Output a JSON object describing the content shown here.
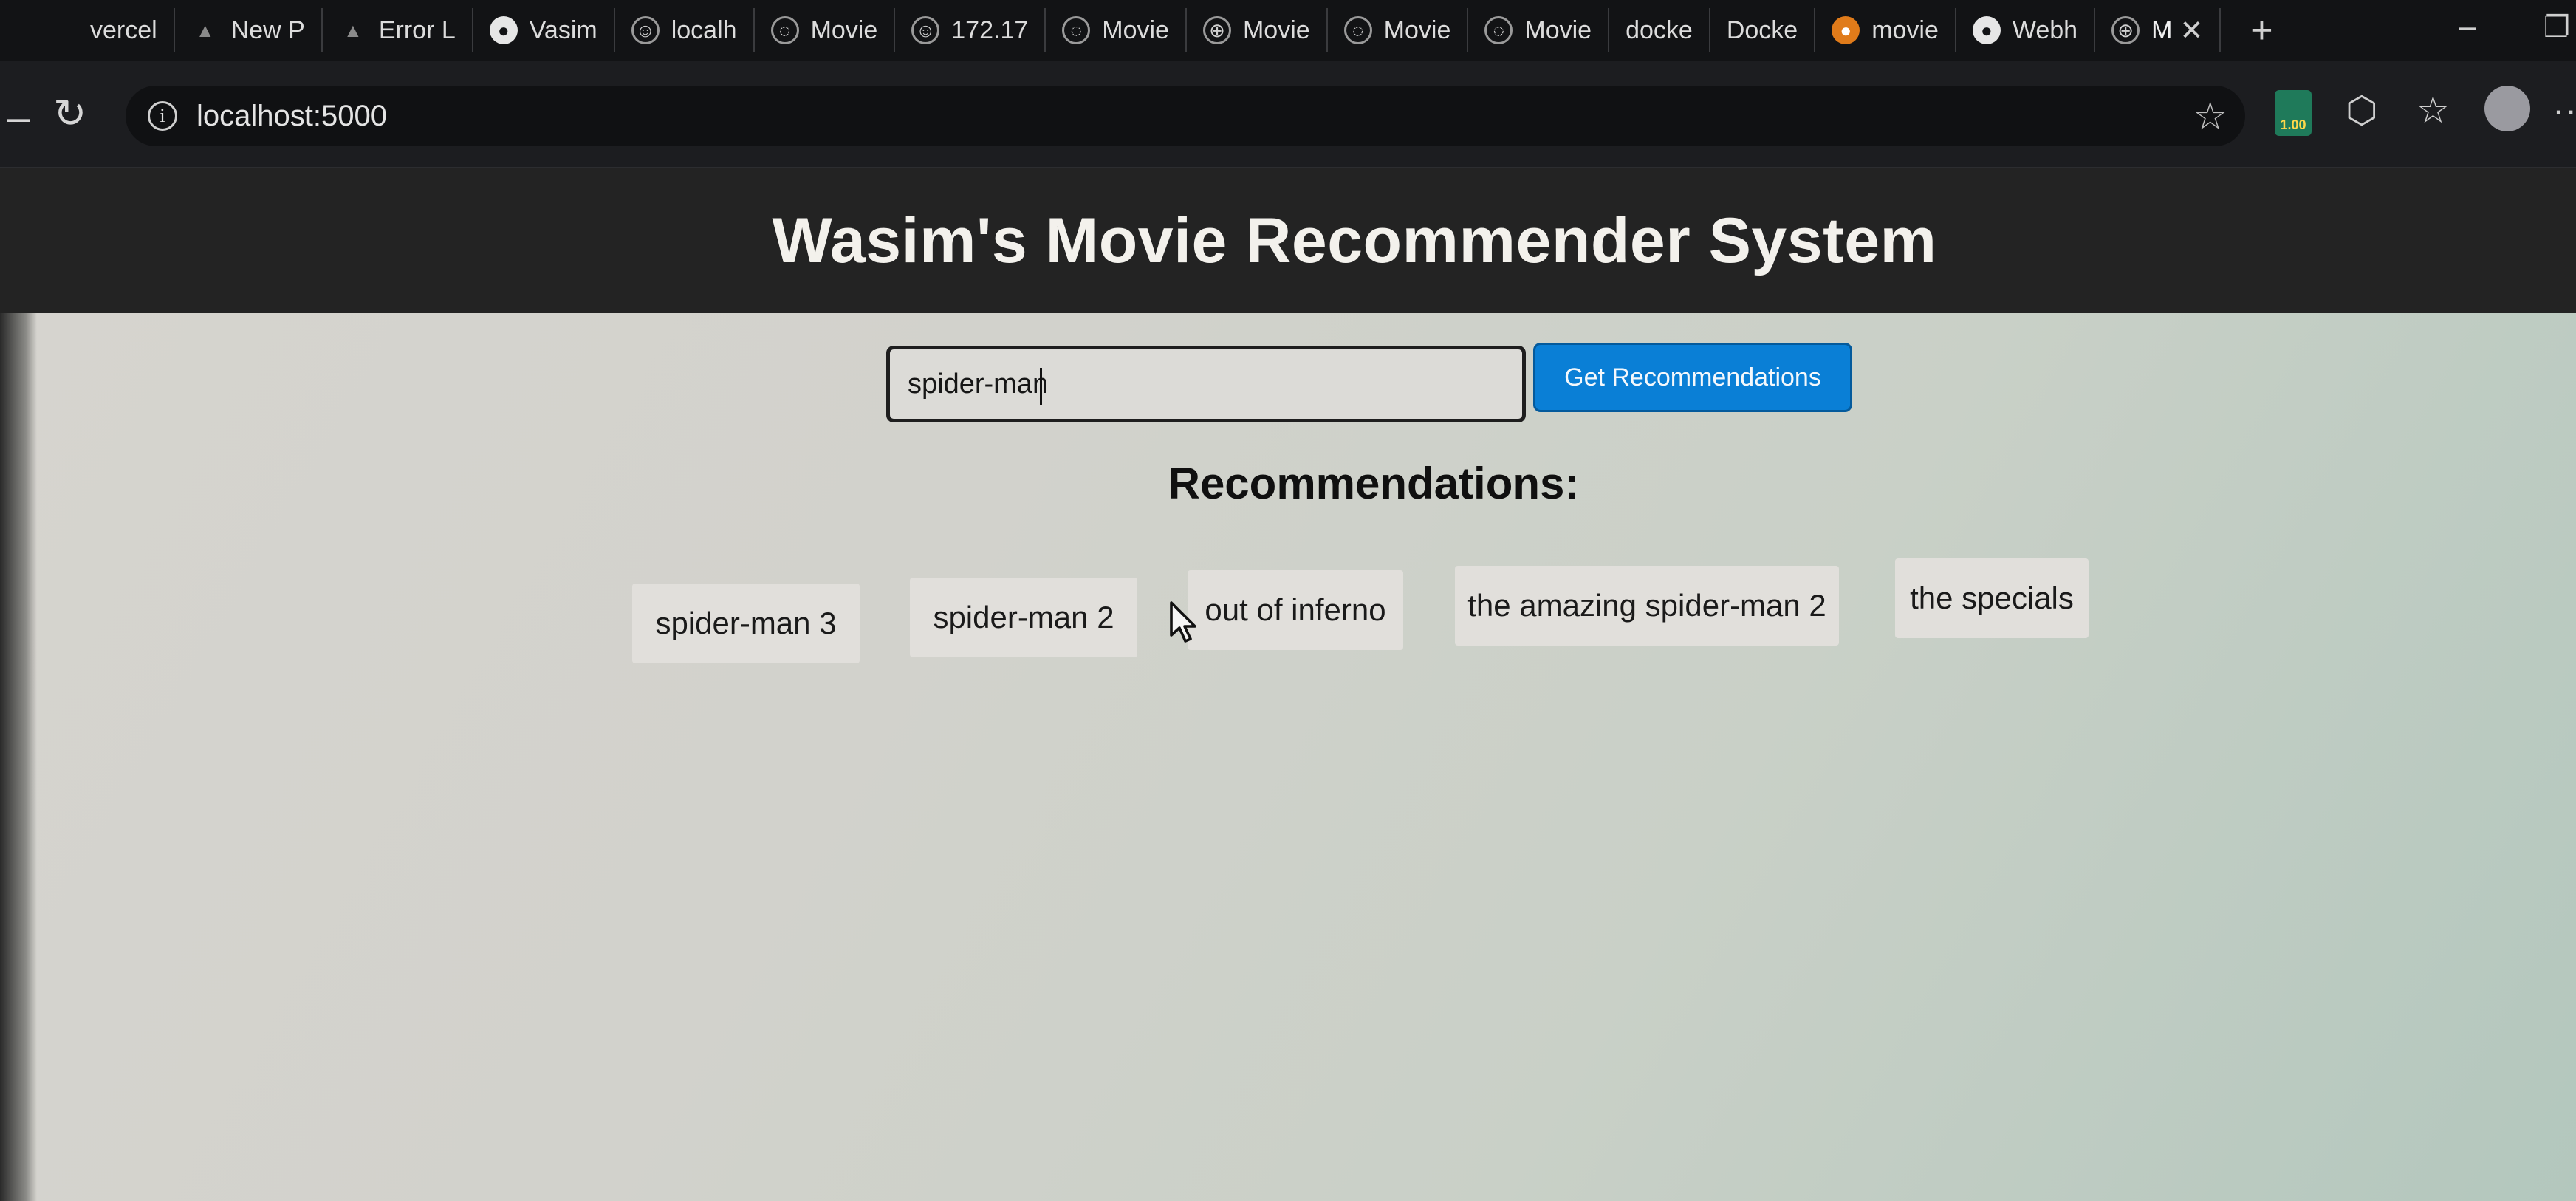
{
  "browser": {
    "tabs": [
      {
        "label": "vercel",
        "icon": "none"
      },
      {
        "label": "New P",
        "icon": "triangle-icon"
      },
      {
        "label": "Error L",
        "icon": "triangle-icon"
      },
      {
        "label": "Vasim",
        "icon": "github-icon"
      },
      {
        "label": "localh",
        "icon": "bot-icon"
      },
      {
        "label": "Movie",
        "icon": "loading-icon"
      },
      {
        "label": "172.17",
        "icon": "bot-icon"
      },
      {
        "label": "Movie",
        "icon": "loading-icon"
      },
      {
        "label": "Movie",
        "icon": "globe-icon"
      },
      {
        "label": "Movie",
        "icon": "loading-icon"
      },
      {
        "label": "Movie",
        "icon": "loading-icon"
      },
      {
        "label": "docke",
        "icon": "none"
      },
      {
        "label": "Docke",
        "icon": "none"
      },
      {
        "label": "movie",
        "icon": "orange-icon"
      },
      {
        "label": "Webh",
        "icon": "github-icon"
      }
    ],
    "active_tab_label": "M",
    "address": "localhost:5000",
    "extension_badge": "1.00"
  },
  "page": {
    "title": "Wasim's Movie Recommender System",
    "search": {
      "value": "spider-man",
      "placeholder": ""
    },
    "button_label": "Get Recommendations",
    "recommendations_heading": "Recommendations:",
    "recommendations": [
      "spider-man 3",
      "spider-man 2",
      "out of inferno",
      "the amazing spider-man 2",
      "the specials"
    ]
  },
  "colors": {
    "header_bg": "#232323",
    "button_bg": "#0a7fd6",
    "card_bg": "#e1dfdb"
  }
}
